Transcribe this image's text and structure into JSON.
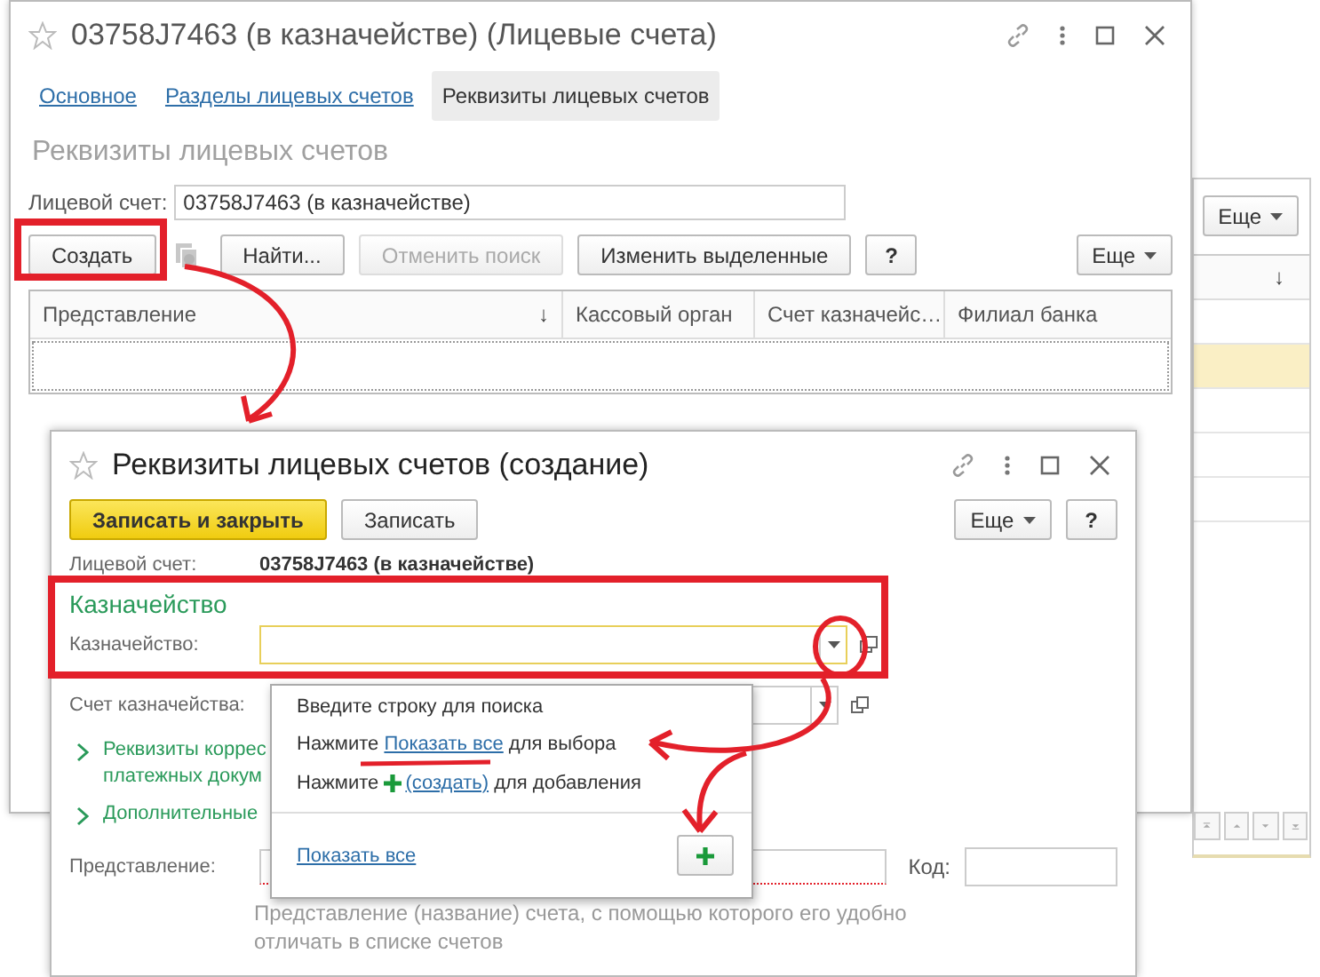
{
  "background_window": {
    "more_button": "Еще",
    "sort_mark": "↓"
  },
  "main_window": {
    "title": "03758J7463 (в казначействе) (Лицевые счета)",
    "tabs": [
      {
        "label": "Основное",
        "selected": false
      },
      {
        "label": "Разделы лицевых счетов",
        "selected": false
      },
      {
        "label": "Реквизиты лицевых счетов",
        "selected": true
      }
    ],
    "section_title": "Реквизиты лицевых счетов",
    "account_field": {
      "label": "Лицевой счет:",
      "value": "03758J7463 (в казначействе)"
    },
    "toolbar": [
      {
        "kind": "button",
        "label": "Создать",
        "disabled": false
      },
      {
        "kind": "copy_icon",
        "disabled": true
      },
      {
        "kind": "button",
        "label": "Найти...",
        "disabled": false
      },
      {
        "kind": "button",
        "label": "Отменить поиск",
        "disabled": true
      },
      {
        "kind": "button",
        "label": "Изменить выделенные",
        "disabled": false
      },
      {
        "kind": "help",
        "label": "?",
        "disabled": false
      }
    ],
    "more_button": "Еще",
    "table": {
      "columns": [
        {
          "label": "Представление",
          "sort_mark": "↓"
        },
        {
          "label": "Кассовый орган"
        },
        {
          "label": "Счет казначейс…"
        },
        {
          "label": "Филиал банка"
        }
      ]
    }
  },
  "create_window": {
    "title": "Реквизиты лицевых счетов (создание)",
    "buttons": [
      {
        "kind": "primary",
        "label": "Записать и закрыть"
      },
      {
        "kind": "default",
        "label": "Записать"
      }
    ],
    "more_button": "Еще",
    "help_button": "?",
    "account": {
      "label": "Лицевой счет:",
      "value": "03758J7463 (в казначействе)"
    },
    "group_title": "Казначейство",
    "treasury_field": {
      "label": "Казначейство:"
    },
    "treasury_account_field": {
      "label": "Счет казначейства:"
    },
    "expanders": [
      {
        "lines": [
          "Реквизиты коррес",
          "платежных докум"
        ]
      },
      {
        "lines": [
          "Дополнительные"
        ]
      }
    ],
    "name_field": {
      "label": "Представление:"
    },
    "code_field": {
      "label": "Код:"
    },
    "hint": "Представление (название) счета, с помощью которого его удобно отличать в списке счетов"
  },
  "dropdown": {
    "lines": [
      {
        "kind": "text",
        "text": "Введите строку для поиска"
      },
      {
        "kind": "link",
        "before": "Нажмите",
        "link": "Показать все",
        "after": "для выбора"
      },
      {
        "kind": "plus_link",
        "before": "Нажмите",
        "link": "(создать)",
        "after": "для добавления"
      }
    ],
    "footer_link": "Показать все"
  }
}
